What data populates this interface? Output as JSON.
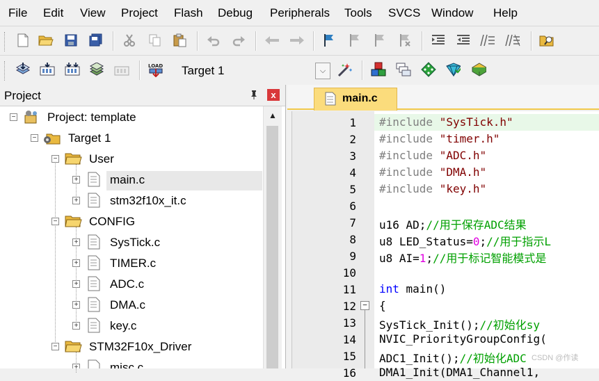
{
  "menu": [
    "File",
    "Edit",
    "View",
    "Project",
    "Flash",
    "Debug",
    "Peripherals",
    "Tools",
    "SVCS",
    "Window",
    "Help"
  ],
  "toolbar2": {
    "target": "Target 1"
  },
  "project_panel": {
    "title": "Project",
    "pin": "⭿",
    "close": "x",
    "tree": [
      {
        "label": "Project: template",
        "kind": "project",
        "level": 0
      },
      {
        "label": "Target 1",
        "kind": "target",
        "level": 1
      },
      {
        "label": "User",
        "kind": "folder",
        "level": 2
      },
      {
        "label": "main.c",
        "kind": "file",
        "level": 3,
        "selected": true
      },
      {
        "label": "stm32f10x_it.c",
        "kind": "file",
        "level": 3
      },
      {
        "label": "CONFIG",
        "kind": "folder",
        "level": 2
      },
      {
        "label": "SysTick.c",
        "kind": "file",
        "level": 3
      },
      {
        "label": "TIMER.c",
        "kind": "file",
        "level": 3
      },
      {
        "label": "ADC.c",
        "kind": "file",
        "level": 3
      },
      {
        "label": "DMA.c",
        "kind": "file",
        "level": 3
      },
      {
        "label": "key.c",
        "kind": "file",
        "level": 3
      },
      {
        "label": "STM32F10x_Driver",
        "kind": "folder",
        "level": 2
      },
      {
        "label": "misc.c",
        "kind": "file",
        "level": 3
      }
    ]
  },
  "editor": {
    "tab": "main.c",
    "lines": [
      {
        "n": "1",
        "tokens": [
          [
            "pp",
            "#include "
          ],
          [
            "str",
            "\"SysTick.h\""
          ]
        ],
        "highlight": true
      },
      {
        "n": "2",
        "tokens": [
          [
            "pp",
            "#include "
          ],
          [
            "str",
            "\"timer.h\""
          ]
        ]
      },
      {
        "n": "3",
        "tokens": [
          [
            "pp",
            "#include "
          ],
          [
            "str",
            "\"ADC.h\""
          ]
        ]
      },
      {
        "n": "4",
        "tokens": [
          [
            "pp",
            "#include "
          ],
          [
            "str",
            "\"DMA.h\""
          ]
        ]
      },
      {
        "n": "5",
        "tokens": [
          [
            "pp",
            "#include "
          ],
          [
            "str",
            "\"key.h\""
          ]
        ]
      },
      {
        "n": "6",
        "tokens": []
      },
      {
        "n": "7",
        "tokens": [
          [
            "",
            "u16 AD;"
          ],
          [
            "cm",
            "//用于保存ADC结果"
          ]
        ]
      },
      {
        "n": "8",
        "tokens": [
          [
            "",
            "u8 LED_Status="
          ],
          [
            "num",
            "0"
          ],
          [
            "",
            ";"
          ],
          [
            "cm",
            "//用于指示L"
          ]
        ]
      },
      {
        "n": "9",
        "tokens": [
          [
            "",
            "u8 AI="
          ],
          [
            "num",
            "1"
          ],
          [
            "",
            ";"
          ],
          [
            "cm",
            "//用于标记智能模式是"
          ]
        ]
      },
      {
        "n": "10",
        "tokens": []
      },
      {
        "n": "11",
        "tokens": [
          [
            "kw",
            "int"
          ],
          [
            "",
            " main()"
          ]
        ]
      },
      {
        "n": "12",
        "tokens": [
          [
            "",
            "{"
          ]
        ],
        "fold": true
      },
      {
        "n": "13",
        "tokens": [
          [
            "",
            "  SysTick_Init();"
          ],
          [
            "cm",
            "//初始化sy"
          ]
        ]
      },
      {
        "n": "14",
        "tokens": [
          [
            "",
            "  NVIC_PriorityGroupConfig("
          ]
        ]
      },
      {
        "n": "15",
        "tokens": [
          [
            "",
            "  ADC1_Init();"
          ],
          [
            "cm",
            "//初始化ADC"
          ]
        ]
      },
      {
        "n": "16",
        "tokens": [
          [
            "",
            "  DMA1_Init(DMA1_Channel1,"
          ]
        ]
      }
    ]
  },
  "watermark": "CSDN @作读",
  "icons": [
    "new-file-icon",
    "open-folder-icon",
    "save-icon",
    "save-all-icon",
    "cut-icon",
    "copy-icon",
    "paste-icon",
    "undo-icon",
    "redo-icon",
    "nav-back-icon",
    "nav-forward-icon",
    "bookmark-icon",
    "bookmark-prev-icon",
    "bookmark-next-icon",
    "bookmark-clear-icon",
    "indent-icon",
    "unindent-icon",
    "comment-icon",
    "uncomment-icon",
    "find-in-files-icon",
    "translate-icon",
    "build-icon",
    "rebuild-icon",
    "batch-build-icon",
    "stop-build-icon",
    "download-icon",
    "target-options-icon",
    "manage-components-icon",
    "select-packs-icon",
    "run-time-env-icon",
    "pack-installer-icon",
    "manage-project-icon"
  ]
}
